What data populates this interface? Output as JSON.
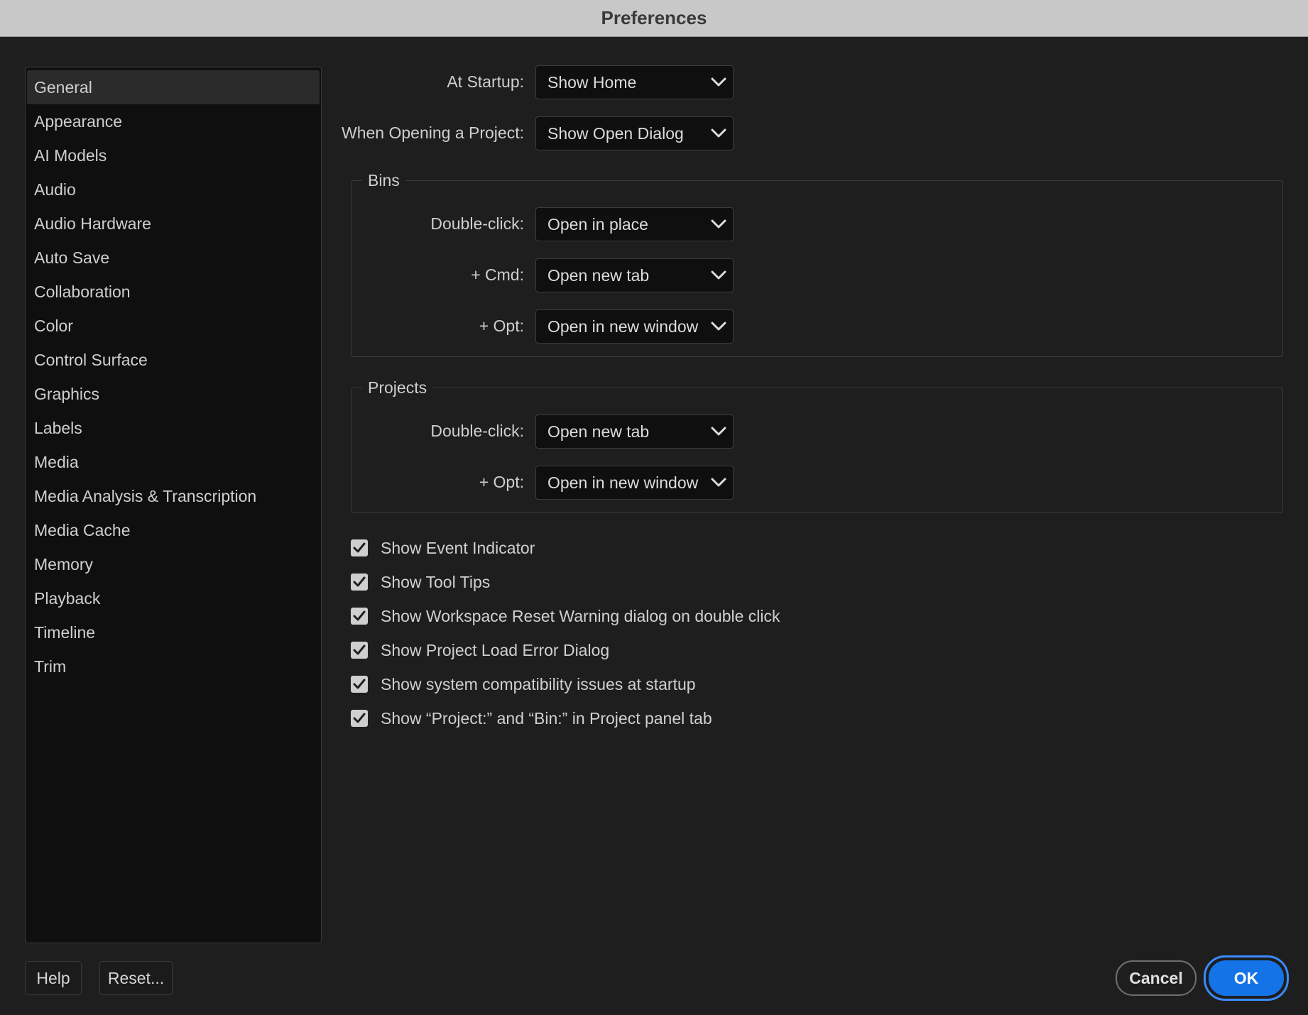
{
  "window": {
    "title": "Preferences"
  },
  "sidebar": {
    "items": [
      {
        "label": "General",
        "selected": true
      },
      {
        "label": "Appearance"
      },
      {
        "label": "AI Models"
      },
      {
        "label": "Audio"
      },
      {
        "label": "Audio Hardware"
      },
      {
        "label": "Auto Save"
      },
      {
        "label": "Collaboration"
      },
      {
        "label": "Color"
      },
      {
        "label": "Control Surface"
      },
      {
        "label": "Graphics"
      },
      {
        "label": "Labels"
      },
      {
        "label": "Media"
      },
      {
        "label": "Media Analysis & Transcription"
      },
      {
        "label": "Media Cache"
      },
      {
        "label": "Memory"
      },
      {
        "label": "Playback"
      },
      {
        "label": "Timeline"
      },
      {
        "label": "Trim"
      }
    ]
  },
  "general": {
    "at_startup": {
      "label": "At Startup:",
      "value": "Show Home"
    },
    "opening_project": {
      "label": "When Opening a Project:",
      "value": "Show Open Dialog"
    },
    "bins": {
      "title": "Bins",
      "double_click": {
        "label": "Double-click:",
        "value": "Open in place"
      },
      "cmd": {
        "label": "+ Cmd:",
        "value": "Open new tab"
      },
      "opt": {
        "label": "+ Opt:",
        "value": "Open in new window"
      }
    },
    "projects": {
      "title": "Projects",
      "double_click": {
        "label": "Double-click:",
        "value": "Open new tab"
      },
      "opt": {
        "label": "+ Opt:",
        "value": "Open in new window"
      }
    },
    "checkboxes": [
      {
        "label": "Show Event Indicator",
        "checked": true
      },
      {
        "label": "Show Tool Tips",
        "checked": true
      },
      {
        "label": "Show Workspace Reset Warning dialog on double click",
        "checked": true
      },
      {
        "label": "Show Project Load Error Dialog",
        "checked": true
      },
      {
        "label": "Show system compatibility issues at startup",
        "checked": true
      },
      {
        "label": "Show “Project:” and “Bin:” in Project panel tab",
        "checked": true
      }
    ]
  },
  "footer": {
    "help": "Help",
    "reset": "Reset...",
    "cancel": "Cancel",
    "ok": "OK"
  },
  "colors": {
    "background": "#1e1e1e",
    "accent": "#1473e6",
    "titlebar": "#c8c8c8"
  },
  "icons": {
    "dropdown": "chevron-down-icon",
    "checkbox": "checkmark-icon"
  }
}
